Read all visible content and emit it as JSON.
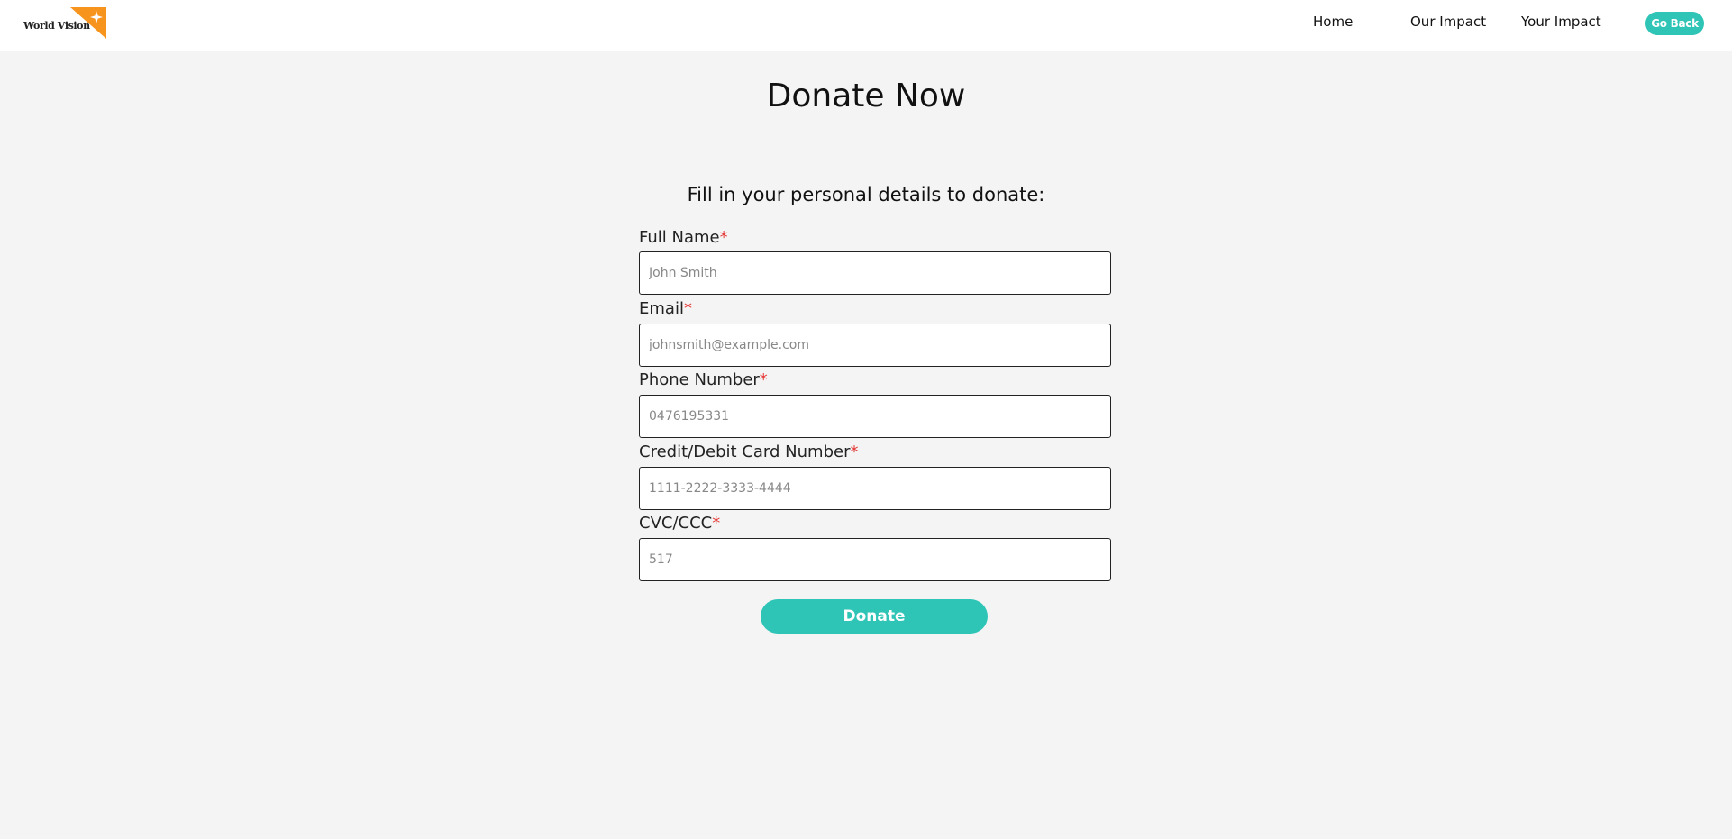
{
  "header": {
    "logo_text": "World Vision",
    "nav": {
      "home": "Home",
      "our_impact": "Our Impact",
      "your_impact": "Your Impact"
    },
    "go_back": "Go Back"
  },
  "main": {
    "title": "Donate Now",
    "form_heading": "Fill in your personal details to donate:",
    "required_marker": "*",
    "fields": {
      "full_name": {
        "label": "Full Name",
        "placeholder": "John Smith"
      },
      "email": {
        "label": "Email",
        "placeholder": "johnsmith@example.com"
      },
      "phone": {
        "label": "Phone Number",
        "placeholder": "0476195331"
      },
      "card": {
        "label": "Credit/Debit Card Number",
        "placeholder": "1111-2222-3333-4444"
      },
      "cvc": {
        "label": "CVC/CCC",
        "placeholder": "517"
      }
    },
    "donate_label": "Donate"
  },
  "colors": {
    "accent": "#2ec4b6",
    "logo_orange": "#f7941d",
    "required": "#e53935",
    "background": "#f4f4f4"
  }
}
